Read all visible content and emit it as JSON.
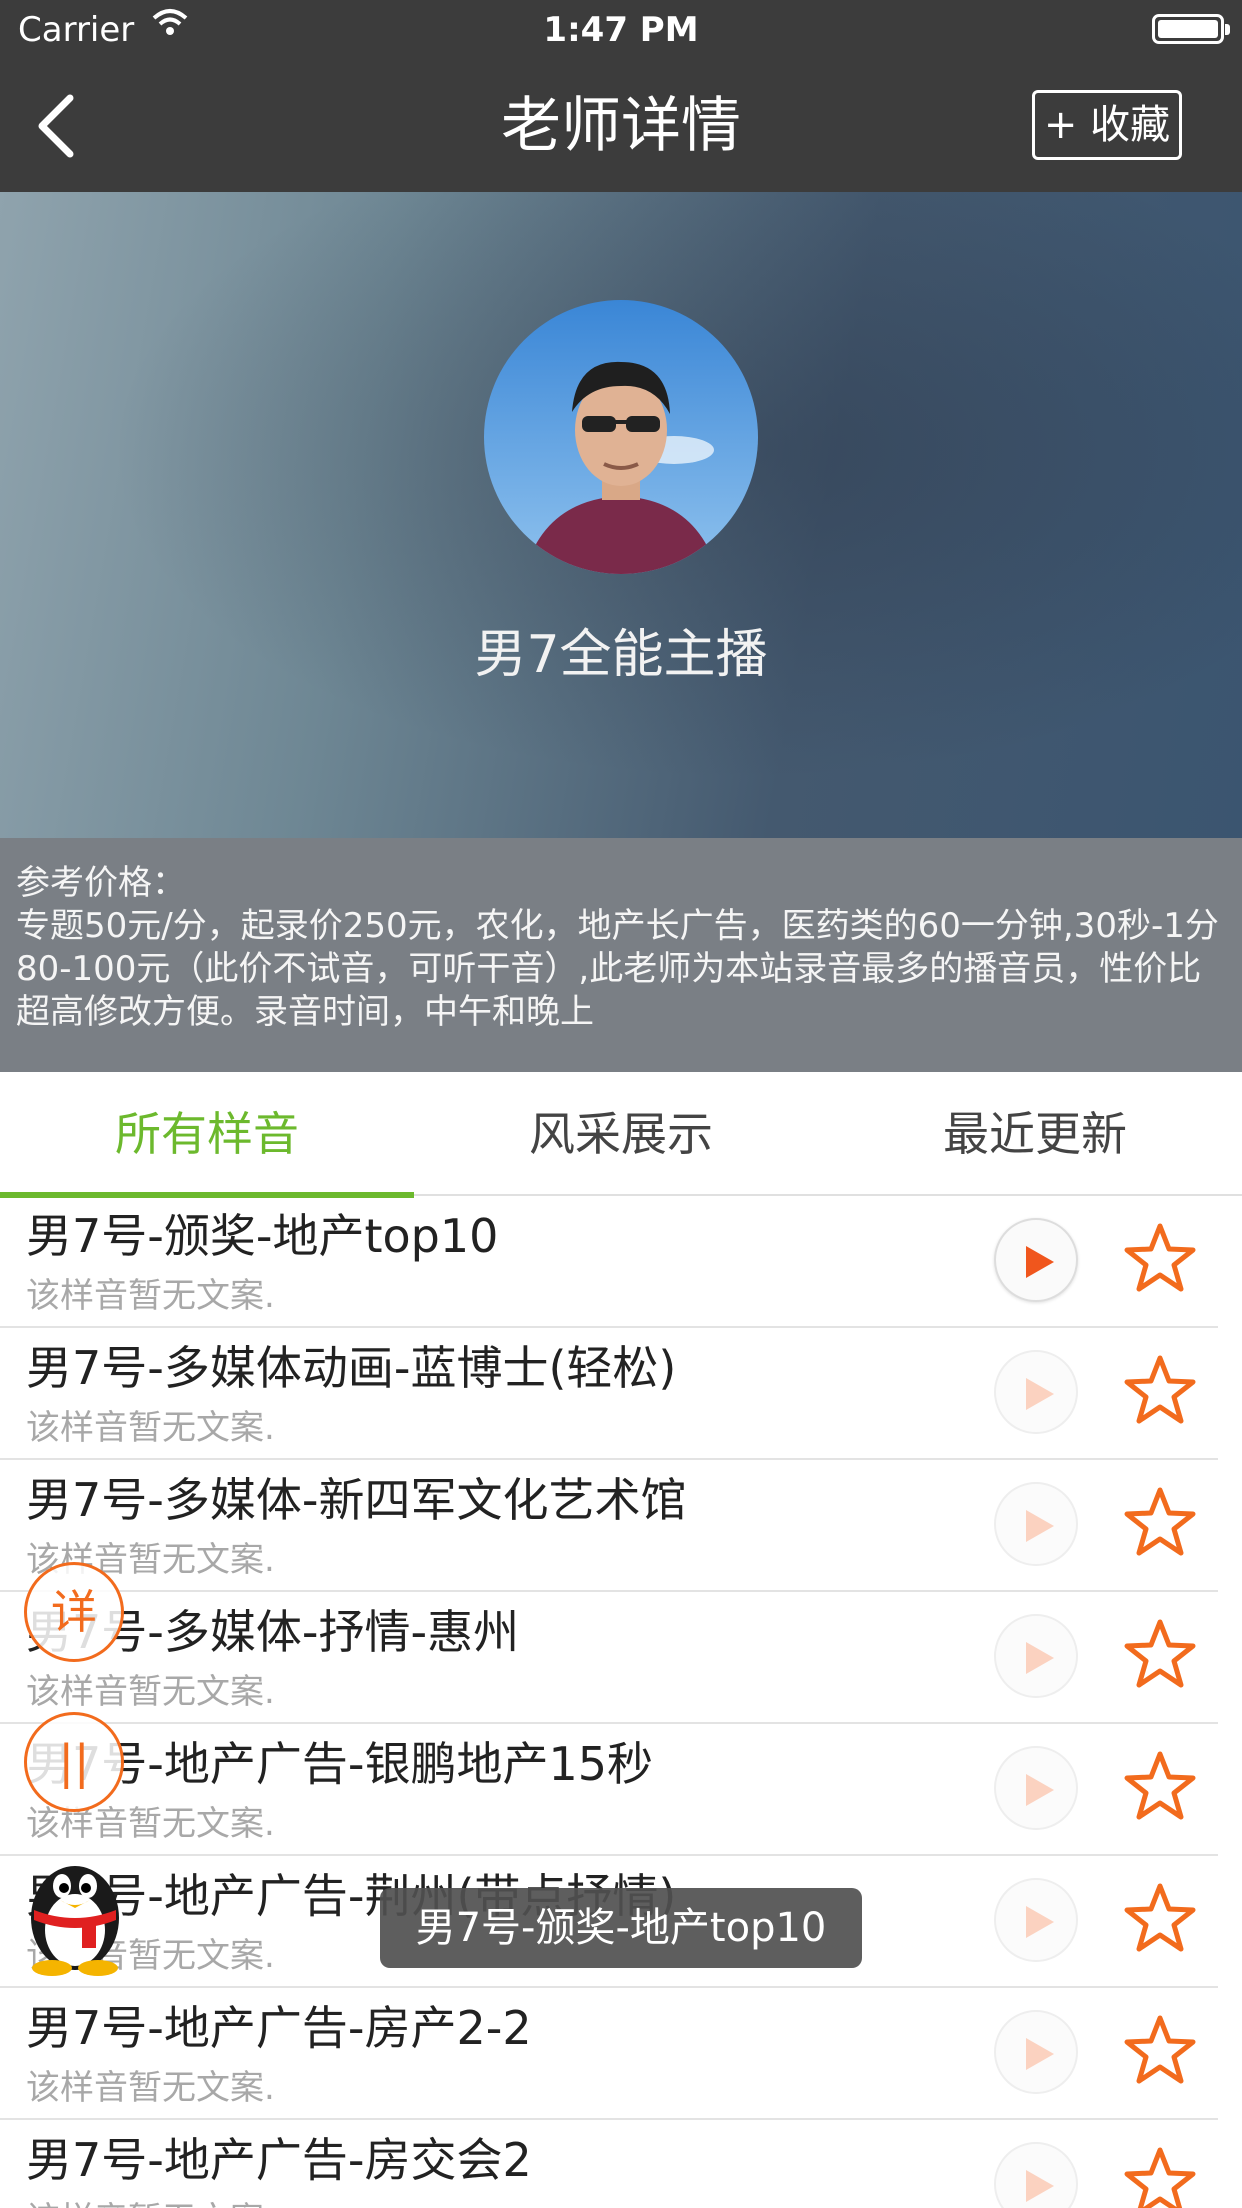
{
  "status_bar": {
    "carrier": "Carrier",
    "time": "1:47 PM"
  },
  "nav": {
    "title": "老师详情",
    "favorite_label": "+ 收藏"
  },
  "profile": {
    "name": "男7全能主播"
  },
  "price": {
    "label": "参考价格：",
    "text": "专题50元/分，起录价250元，农化，地产长广告，医药类的60一分钟,30秒-1分80-100元（此价不试音，可听干音）,此老师为本站录音最多的播音员，性价比超高修改方便。录音时间，中午和晚上"
  },
  "tabs": [
    {
      "label": "所有样音"
    },
    {
      "label": "风采展示"
    },
    {
      "label": "最近更新"
    }
  ],
  "samples": [
    {
      "title": "男7号-颁奖-地产top10",
      "desc": "该样音暂无文案."
    },
    {
      "title": "男7号-多媒体动画-蓝博士(轻松)",
      "desc": "该样音暂无文案."
    },
    {
      "title": "男7号-多媒体-新四军文化艺术馆",
      "desc": "该样音暂无文案."
    },
    {
      "title": "男7号-多媒体-抒情-惠州",
      "desc": "该样音暂无文案."
    },
    {
      "title": "男7号-地产广告-银鹏地产15秒",
      "desc": "该样音暂无文案."
    },
    {
      "title": "男7号-地产广告-荆州(带点抒情)",
      "desc": "该样音暂无文案."
    },
    {
      "title": "男7号-地产广告-房产2-2",
      "desc": "该样音暂无文案."
    },
    {
      "title": "男7号-地产广告-房交会2",
      "desc": "该样音暂无文案."
    }
  ],
  "floating": {
    "detail_label": "详",
    "pause_label": "||"
  },
  "toast": {
    "text": "男7号-颁奖-地产top10"
  },
  "colors": {
    "accent_green": "#6cb92d",
    "accent_orange": "#f26b1d",
    "nav_bg": "#3c3c3c"
  }
}
